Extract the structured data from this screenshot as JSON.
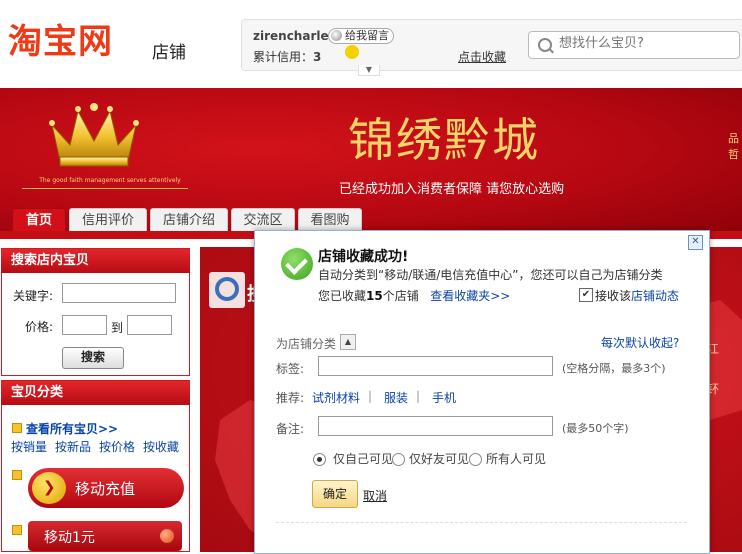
{
  "header": {
    "logo_text": "淘宝网",
    "logo_sub": "店铺",
    "username": "zirencharles",
    "message_button": "给我留言",
    "credit_label": "累计信用：",
    "credit_value": "3",
    "favorite_link": "点击收藏",
    "search_placeholder": "想找什么宝贝?"
  },
  "banner": {
    "shop_name": "锦绣黔城",
    "crown_tagline": "The good faith management serves attentively",
    "guarantee_text": "已经成功加入消费者保障 请您放心选购",
    "right_edge_chars": [
      "品",
      "哲"
    ]
  },
  "nav": {
    "tabs": [
      {
        "label": "首页",
        "active": true
      },
      {
        "label": "信用评价",
        "active": false
      },
      {
        "label": "店铺介绍",
        "active": false
      },
      {
        "label": "交流区",
        "active": false
      },
      {
        "label": "看图购",
        "active": false
      }
    ]
  },
  "sidebar": {
    "search_title": "搜索店内宝贝",
    "keyword_label": "关键字:",
    "price_label": "价格:",
    "price_to": "到",
    "search_button": "搜索",
    "category_title": "宝贝分类",
    "view_all": "查看所有宝贝>>",
    "sort_links": [
      "按销量",
      "按新品",
      "按价格",
      "按收藏"
    ],
    "recharge_button": "移动充值",
    "one_yuan_button": "移动1元"
  },
  "main": {
    "right_text_1": "江",
    "right_text_2": "钚"
  },
  "dialog": {
    "title": "店铺收藏成功!",
    "line1": "自动分类到“移动/联通/电信充值中心”，您还可以自己为店铺分类",
    "line2_prefix": "您已收藏",
    "shop_count": "15",
    "line2_suffix": "个店铺",
    "view_folder_link": "查看收藏夹>>",
    "subscribe_prefix": "接收该",
    "subscribe_link": "店铺动态",
    "subscribe_checked": true,
    "category_label": "为店铺分类",
    "collapse_question": "每次默认收起?",
    "tag_label": "标签:",
    "tag_hint": "(空格分隔，最多3个)",
    "recommend_label": "推荐:",
    "recommend_items": [
      "试剂材料",
      "服装",
      "手机"
    ],
    "note_label": "备注:",
    "note_hint": "(最多50个字)",
    "visibility_options": [
      {
        "label": "仅自己可见",
        "selected": true
      },
      {
        "label": "仅好友可见",
        "selected": false
      },
      {
        "label": "所有人可见",
        "selected": false
      }
    ],
    "ok_button": "确定",
    "cancel_link": "取消"
  },
  "colors": {
    "brand_orange": "#ee3a16",
    "banner_red": "#c40e16",
    "title_gold": "#f5d56a",
    "link_blue": "#0a44a8",
    "success_green": "#3ea21f"
  }
}
